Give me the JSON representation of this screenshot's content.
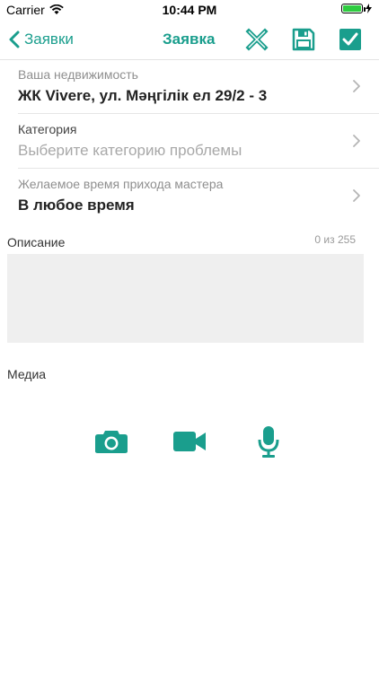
{
  "status_bar": {
    "carrier": "Carrier",
    "time": "10:44 PM"
  },
  "nav": {
    "back_label": "Заявки",
    "title": "Заявка"
  },
  "form": {
    "property": {
      "label": "Ваша недвижимость",
      "value": "ЖК Vivere, ул. Мәңгілік ел 29/2 - 3"
    },
    "category": {
      "label": "Категория",
      "placeholder": "Выберите категорию проблемы"
    },
    "time": {
      "label": "Желаемое время прихода мастера",
      "value": "В любое время"
    }
  },
  "description": {
    "label": "Описание",
    "counter": "0 из 255"
  },
  "media": {
    "label": "Медиа"
  },
  "colors": {
    "accent": "#1a9e8d",
    "battery": "#2ecc40"
  },
  "icons": {
    "nav": [
      "chevron-left-icon",
      "close-cross-icon",
      "save-floppy-icon",
      "checkbox-confirm-icon"
    ],
    "media": [
      "camera-icon",
      "video-camera-icon",
      "microphone-icon"
    ]
  }
}
